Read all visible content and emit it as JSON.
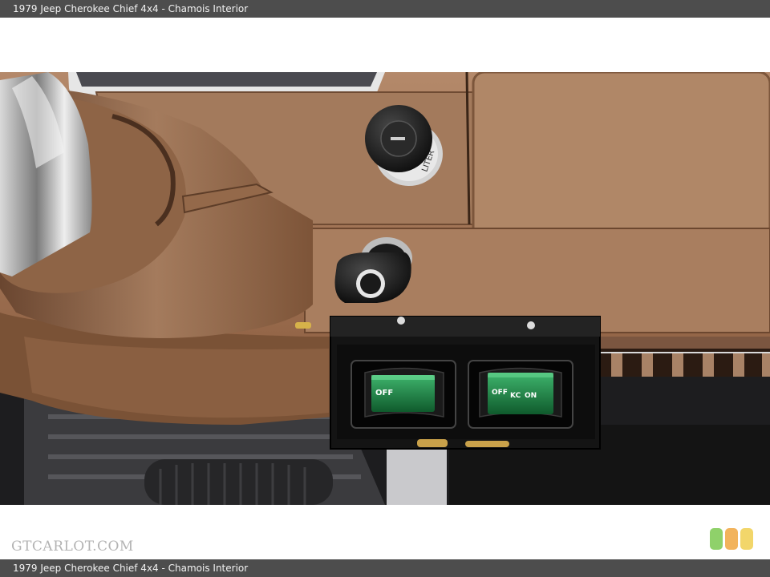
{
  "header": {
    "caption": "1979 Jeep Cherokee Chief 4x4 - Chamois Interior"
  },
  "footer": {
    "caption": "1979 Jeep Cherokee Chief 4x4 - Chamois Interior"
  },
  "watermark": {
    "text": "GTCARLOT.COM"
  },
  "photo": {
    "switch_left": {
      "off": "OFF"
    },
    "switch_right": {
      "off": "OFF",
      "kc": "KC",
      "on": "ON"
    },
    "knob_text": "LITER"
  },
  "colors": {
    "dash": "#a67c5b",
    "dash_dark": "#7a5236",
    "switch_green": "#1e8c4a",
    "bar_bg": "#4d4d4d",
    "grade_green": "#8fd16a",
    "grade_orange": "#f2b35c",
    "grade_yellow": "#f2d66a"
  }
}
